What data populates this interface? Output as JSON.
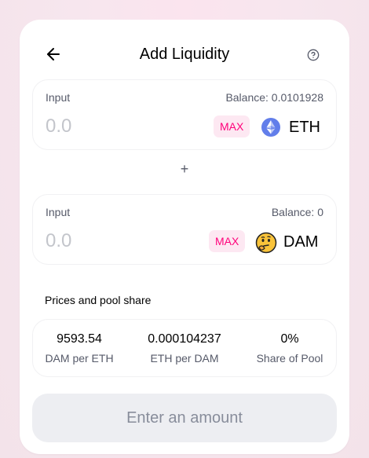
{
  "header": {
    "title": "Add Liquidity",
    "back_icon": "arrow-left-icon",
    "help_icon": "question-circle-icon"
  },
  "currency_a": {
    "label": "Input",
    "balance": "Balance: 0.0101928",
    "placeholder": "0.0",
    "max_label": "MAX",
    "symbol": "ETH",
    "icon": "ethereum-icon"
  },
  "plus_sign": "+",
  "currency_b": {
    "label": "Input",
    "balance": "Balance: 0",
    "placeholder": "0.0",
    "max_label": "MAX",
    "symbol": "DAM",
    "icon": "thinking-face-icon"
  },
  "prices": {
    "title": "Prices and pool share",
    "items": [
      {
        "value": "9593.54",
        "label": "DAM per ETH"
      },
      {
        "value": "0.000104237",
        "label": "ETH per DAM"
      },
      {
        "value": "0%",
        "label": "Share of Pool"
      }
    ]
  },
  "submit": {
    "label": "Enter an amount"
  },
  "colors": {
    "accent": "#ff007a",
    "accent_bg": "#fde8f2",
    "muted_text": "#565a69",
    "placeholder": "#c3c5cb",
    "disabled_bg": "#edeef2",
    "disabled_text": "#888d9b"
  }
}
